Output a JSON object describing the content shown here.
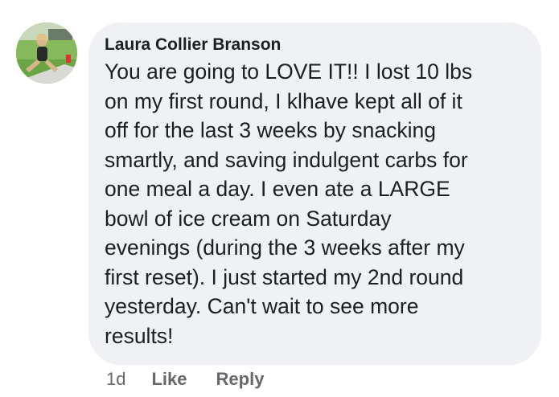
{
  "comment": {
    "author": "Laura Collier Branson",
    "lines": [
      "You are going to LOVE IT!! I lost 10 lbs",
      "on my first round, I klhave kept all of it",
      "off for the last 3 weeks by snacking",
      "smartly, and saving indulgent carbs for",
      "one meal a day. I even ate a LARGE",
      "bowl of ice cream on Saturday",
      "evenings (during the 3 weeks after my",
      "first reset). I just started my 2nd round",
      "yesterday. Can't wait to see more",
      "results!"
    ],
    "avatar_icon": "profile-photo",
    "bubble_color": "#eff1f4"
  },
  "actions": {
    "age": "1d",
    "like_label": "Like",
    "reply_label": "Reply"
  }
}
